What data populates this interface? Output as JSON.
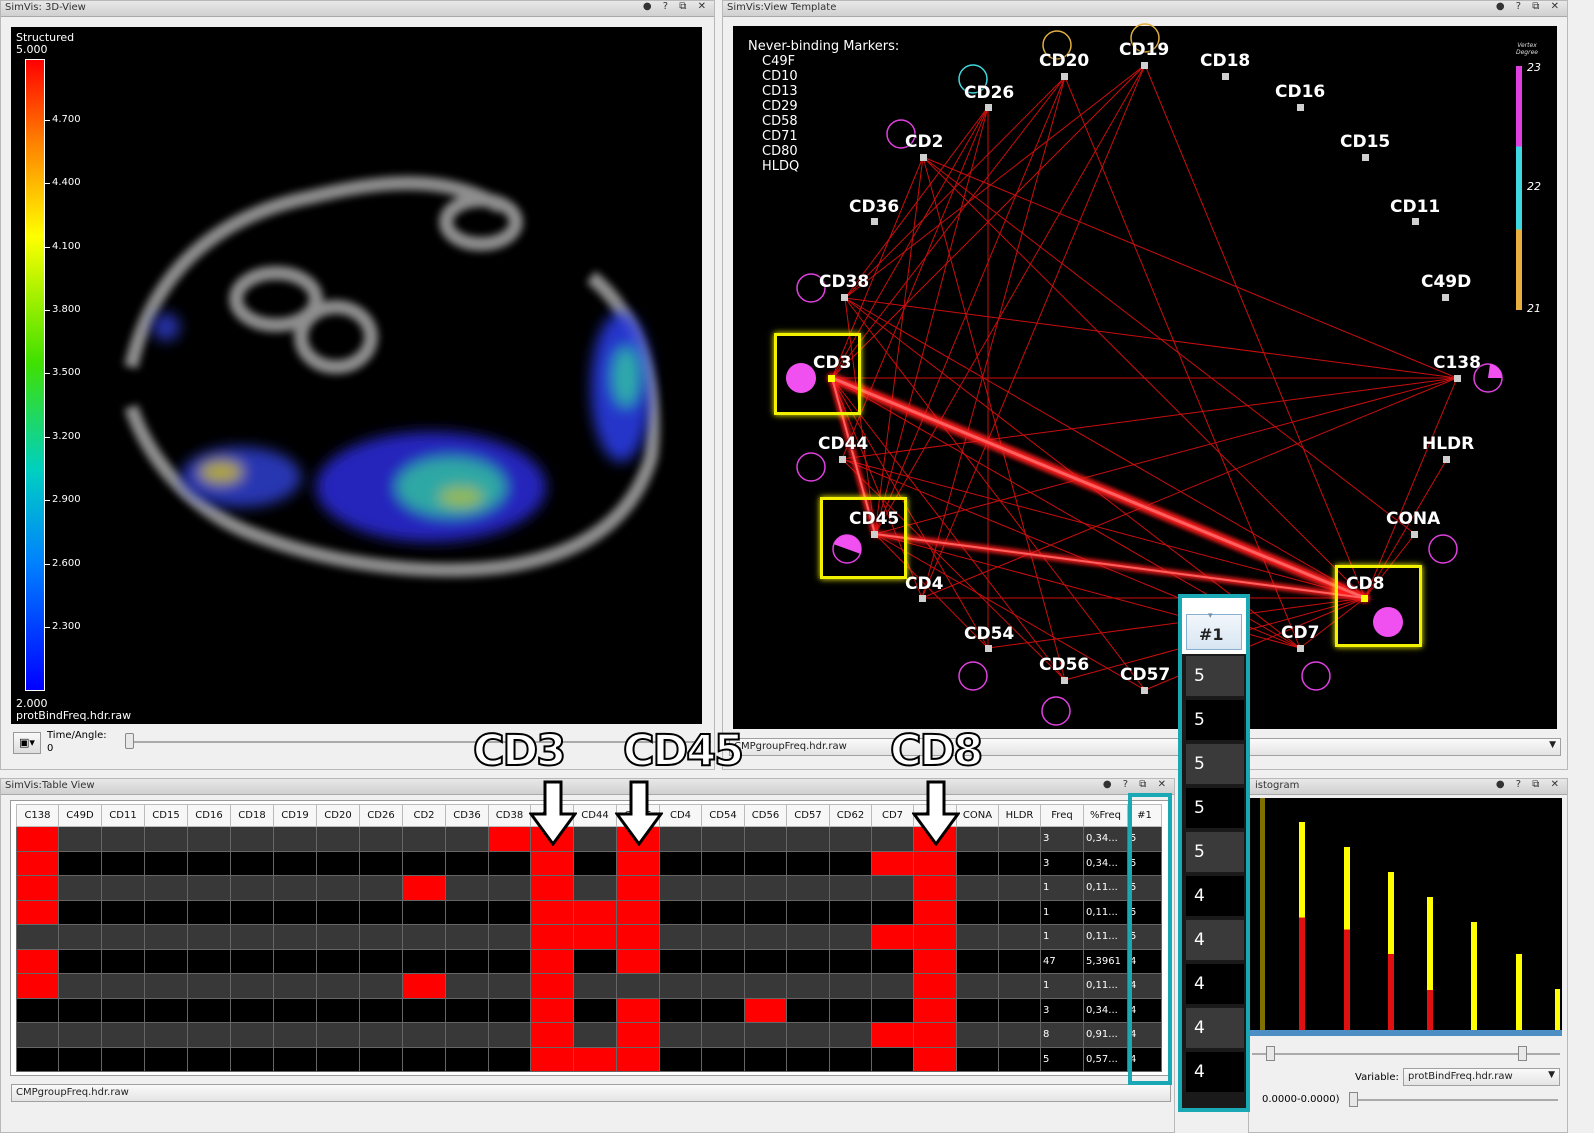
{
  "pane3d": {
    "title": "SimVis: 3D-View",
    "colorscale_label": "Structured",
    "max": "5.000",
    "min": "2.000",
    "ticks": [
      "4.700",
      "4.400",
      "4.100",
      "3.800",
      "3.500",
      "3.200",
      "2.900",
      "2.600",
      "2.300"
    ],
    "filename": "protBindFreq.hdr.raw",
    "time_label": "Time/Angle:",
    "time_value": "0"
  },
  "paneview": {
    "title": "SimVis:View Template",
    "never_title": "Never-binding Markers:",
    "never": [
      "C49F",
      "CD10",
      "CD13",
      "CD29",
      "CD58",
      "CD71",
      "CD80",
      "HLDQ"
    ],
    "vertex_degree_label": "Vertex Degree",
    "vd": [
      "23",
      "22",
      "21"
    ],
    "combo": "CMPgroupFreq.hdr.raw",
    "nodes": {
      "CD20": "CD20",
      "CD19": "CD19",
      "CD18": "CD18",
      "CD26": "CD26",
      "CD16": "CD16",
      "CD2": "CD2",
      "CD15": "CD15",
      "CD36": "CD36",
      "CD11": "CD11",
      "CD38": "CD38",
      "C49D": "C49D",
      "CD3": "CD3",
      "C138": "C138",
      "CD44": "CD44",
      "HLDR": "HLDR",
      "CD45": "CD45",
      "CONA": "CONA",
      "CD8": "CD8",
      "CD4": "CD4",
      "CD54": "CD54",
      "CD7": "CD7",
      "CD56": "CD56",
      "CD57": "CD57"
    }
  },
  "annot": {
    "cd3": "CD3",
    "cd45": "CD45",
    "cd8": "CD8"
  },
  "table": {
    "title": "SimVis:Table View",
    "headers": [
      "C138",
      "C49D",
      "CD11",
      "CD15",
      "CD16",
      "CD18",
      "CD19",
      "CD20",
      "CD26",
      "CD2",
      "CD36",
      "CD38",
      "CD3",
      "CD44",
      "CD45",
      "CD4",
      "CD54",
      "CD56",
      "CD57",
      "CD62",
      "CD7",
      "CD8",
      "CONA",
      "HLDR",
      "Freq",
      "%Freq",
      "#1"
    ],
    "rows": [
      {
        "red": [
          0,
          11,
          12,
          14,
          21
        ],
        "freq": "3",
        "pct": "0,34...",
        "n": "5"
      },
      {
        "red": [
          0,
          12,
          14,
          20,
          21
        ],
        "freq": "3",
        "pct": "0,34...",
        "n": "5"
      },
      {
        "red": [
          0,
          9,
          12,
          14,
          21
        ],
        "freq": "1",
        "pct": "0,11...",
        "n": "5"
      },
      {
        "red": [
          0,
          12,
          13,
          14,
          21
        ],
        "freq": "1",
        "pct": "0,11...",
        "n": "5"
      },
      {
        "red": [
          12,
          13,
          14,
          20,
          21
        ],
        "freq": "1",
        "pct": "0,11...",
        "n": "5"
      },
      {
        "red": [
          0,
          12,
          14,
          21
        ],
        "freq": "47",
        "pct": "5,3961",
        "n": "4"
      },
      {
        "red": [
          0,
          9,
          12,
          21
        ],
        "freq": "1",
        "pct": "0,11...",
        "n": "4"
      },
      {
        "red": [
          12,
          14,
          17,
          21
        ],
        "freq": "3",
        "pct": "0,34...",
        "n": "4"
      },
      {
        "red": [
          12,
          14,
          20,
          21
        ],
        "freq": "8",
        "pct": "0,91...",
        "n": "4"
      },
      {
        "red": [
          12,
          13,
          14,
          21
        ],
        "freq": "5",
        "pct": "0,57...",
        "n": "4"
      }
    ],
    "combo": "CMPgroupFreq.hdr.raw"
  },
  "callout": {
    "header": "#1",
    "values": [
      "5",
      "5",
      "5",
      "5",
      "5",
      "4",
      "4",
      "4",
      "4",
      "4"
    ]
  },
  "histo": {
    "title": "istogram",
    "variable_label": "Variable:",
    "variable": "protBindFreq.hdr.raw",
    "range": "0.0000-0.0000)"
  }
}
